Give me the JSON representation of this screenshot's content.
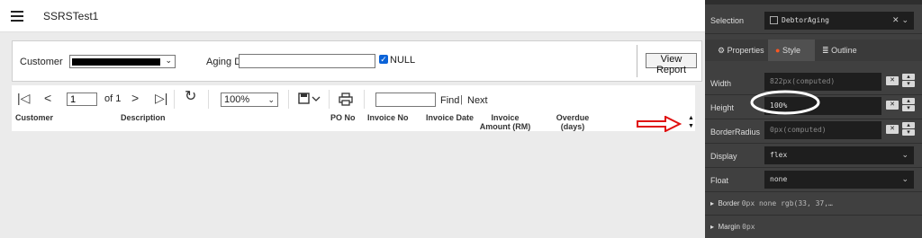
{
  "app": {
    "title": "SSRSTest1"
  },
  "parameters": {
    "customer_label": "Customer",
    "aging_label": "Aging Days",
    "aging_value": "",
    "null_label": "NULL",
    "null_checked": true,
    "view_report_label": "View Report"
  },
  "toolbar": {
    "first_icon": "first-page-icon",
    "prev_icon": "previous-page-icon",
    "page_value": "1",
    "of_label": "of 1",
    "next_icon": "next-page-icon",
    "last_icon": "last-page-icon",
    "refresh_icon": "refresh-icon",
    "zoom_value": "100%",
    "save_icon": "save-icon",
    "print_icon": "print-icon",
    "find_value": "",
    "find_label": "Find",
    "separator": "|",
    "next_label": "Next"
  },
  "report": {
    "columns": [
      "Customer",
      "Description",
      "PO No",
      "Invoice No",
      "Invoice Date",
      "Invoice Amount (RM)",
      "Overdue (days)"
    ]
  },
  "inspector": {
    "selection_label": "Selection",
    "selection_value": "DebtorAging",
    "tabs": [
      "Properties",
      "Style",
      "Outline"
    ],
    "active_tab": "Style",
    "width_label": "Width",
    "width_value": "822px(computed)",
    "height_label": "Height",
    "height_value": "100%",
    "radius_label": "BorderRadius",
    "radius_value": "0px(computed)",
    "display_label": "Display",
    "display_value": "flex",
    "float_label": "Float",
    "float_value": "none",
    "border_label": "Border",
    "border_value": "0px none rgb(33, 37,…",
    "margin_label": "Margin",
    "margin_value": "0px"
  },
  "colors": {
    "accent": "#0b63d8",
    "annotation_arrow": "#e01010",
    "inspector_bg": "#404040",
    "style_dot": "#ff5722"
  }
}
